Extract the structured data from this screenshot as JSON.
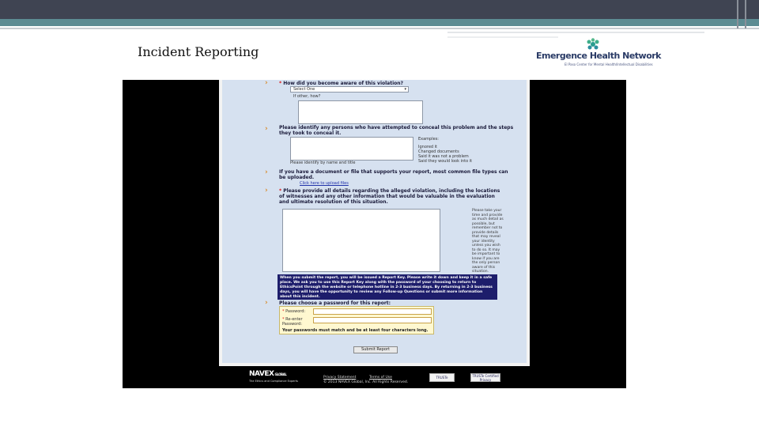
{
  "slide": {
    "title": "Incident Reporting"
  },
  "logo": {
    "name": "Emergence Health Network",
    "subtitle": "El Paso Center for Mental Health/Intellectual Disabilities",
    "colors": [
      "#2a9d8f",
      "#2a3b66"
    ]
  },
  "form": {
    "q_aware": "How did you become aware of this violation?",
    "aware_select": "Select One",
    "if_other": "If other, how?",
    "q_conceal": "Please identify any persons who have attempted to conceal this problem and the steps they took to conceal it.",
    "conceal_hint": "Please identify by name and title",
    "examples_title": "Examples:",
    "examples": [
      "Ignored it",
      "Changed documents",
      "Said it was not a problem",
      "Said they would look into it"
    ],
    "q_upload": "If you have a document or file that supports your report, most common file types can be uploaded.",
    "upload_link": "Click here to upload files",
    "q_details": "Please provide all details regarding the alleged violation, including the locations of witnesses and any other information that would be valuable in the evaluation and ultimate resolution of this situation.",
    "details_hint": "Please take your time and provide as much detail as possible, but remember not to provide details that may reveal your identity unless you wish to do so. It may be important to know if you are the only person aware of this situation.",
    "notice": "When you submit the report, you will be issued a Report Key. Please write it down and keep it in a safe place. We ask you to use this Report Key along with the password of your choosing to return to EthicsPoint through the website or telephone hotline in 2-3 business days. By returning in 2-3 business days, you will have the opportunity to review any Follow-up Questions or submit more information about this incident.",
    "q_password": "Please choose a password for this report:",
    "password_label": "Password:",
    "reenter_label": "Re-enter Password:",
    "password_rule": "Your passwords must match and be at least four characters long.",
    "submit": "Submit Report"
  },
  "footer": {
    "brand": "NAVEX",
    "brand_suffix": "GLOBAL",
    "brand_tagline": "The Ethics and Compliance Experts",
    "privacy": "Privacy Statement",
    "terms": "Terms of Use",
    "copyright": "© 2013 NAVEX Global, Inc. All Rights Reserved.",
    "badge1": "TRUSTe",
    "badge2": "TRUSTe Certified Privacy"
  },
  "colors": {
    "form_bg": "#d6e1f0",
    "notice_bg": "#1d1d6b",
    "arrow": "#d98a2b",
    "topbar": "#3f4452",
    "teal": "#5d8c93"
  }
}
